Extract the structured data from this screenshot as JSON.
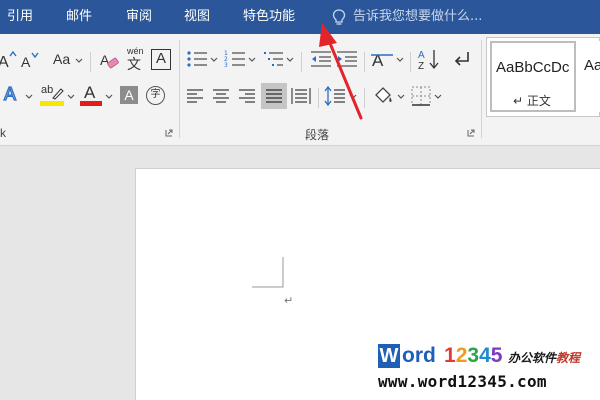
{
  "tabs": [
    {
      "label": "引用",
      "name": "tab-references"
    },
    {
      "label": "邮件",
      "name": "tab-mailings"
    },
    {
      "label": "审阅",
      "name": "tab-review"
    },
    {
      "label": "视图",
      "name": "tab-view"
    },
    {
      "label": "特色功能",
      "name": "tab-special-features"
    }
  ],
  "tell_me": {
    "placeholder": "告诉我您想要做什么..."
  },
  "ribbon": {
    "font_group": {
      "change_case_label": "Aa",
      "phonetic_guide_label": "wén",
      "phonetic_guide_char": "文",
      "character_border_label": "A",
      "text_effects_label": "A",
      "highlight_label": "ab",
      "font_color_label": "A",
      "character_shading_label": "A",
      "enclose_char_label": "字",
      "truncated_label": "k",
      "highlight_color": "#f6e600",
      "font_color": "#e31b1b"
    },
    "paragraph_group": {
      "label": "段落"
    },
    "styles": [
      {
        "sample": "AaBbCcDc",
        "name": "↵ 正文"
      },
      {
        "sample": "AaB",
        "name": ""
      }
    ]
  },
  "document": {
    "paragraph_mark": "↵"
  },
  "watermark": {
    "logo_letter": "W",
    "logo_rest": "ord",
    "logo_numbers": [
      "1",
      "2",
      "3",
      "4",
      "5"
    ],
    "logo_number_colors": [
      "#e23a3a",
      "#f29a1c",
      "#2aa34a",
      "#1f8ad1",
      "#7d3ac1"
    ],
    "tagline_a": "办公软件",
    "tagline_b": "教程",
    "url": "www.word12345.com"
  },
  "colors": {
    "tab_bar": "#2b579a",
    "ribbon": "#f3f3f3",
    "annotation_arrow": "#e2252b"
  }
}
